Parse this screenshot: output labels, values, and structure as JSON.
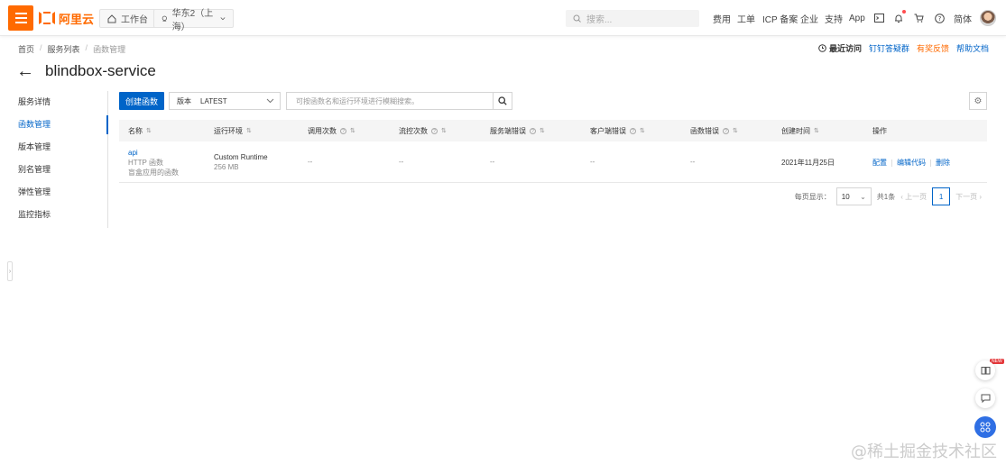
{
  "topbar": {
    "brand": "阿里云",
    "workbench": "工作台",
    "region": "华东2（上海）",
    "search_placeholder": "搜索...",
    "nav": [
      "费用",
      "工单",
      "ICP 备案",
      "企业",
      "支持",
      "App"
    ],
    "lang": "简体"
  },
  "breadcrumb": [
    "首页",
    "服务列表",
    "函数管理"
  ],
  "quick_links": {
    "recent": "最近访问",
    "dingtalk": "钉钉答疑群",
    "feedback": "有奖反馈",
    "help": "帮助文档"
  },
  "page_title": "blindbox-service",
  "sidenav": {
    "items": [
      "服务详情",
      "函数管理",
      "版本管理",
      "别名管理",
      "弹性管理",
      "监控指标"
    ],
    "active_index": 1
  },
  "toolbar": {
    "create_label": "创建函数",
    "version_label": "版本",
    "version_value": "LATEST",
    "search_placeholder": "可按函数名和运行环境进行模糊搜索。"
  },
  "table": {
    "columns": [
      "名称",
      "运行环境",
      "调用次数",
      "流控次数",
      "服务端错误",
      "客户端错误",
      "函数错误",
      "创建时间",
      "操作"
    ],
    "rows": [
      {
        "name": "api",
        "trigger": "HTTP 函数",
        "desc": "盲盒应用的函数",
        "runtime": "Custom Runtime",
        "memory": "256 MB",
        "invocations": "--",
        "throttles": "--",
        "server_errors": "--",
        "client_errors": "--",
        "function_errors": "--",
        "created": "2021年11月25日",
        "actions": [
          "配置",
          "编辑代码",
          "删除"
        ]
      }
    ]
  },
  "pagination": {
    "per_page_label": "每页显示：",
    "per_page": "10",
    "total": "共1条",
    "prev": "上一页",
    "current": "1",
    "next": "下一页"
  },
  "float_badge": "NEW",
  "watermark": "@稀土掘金技术社区",
  "colors": {
    "brand": "#ff6a00",
    "primary": "#0064c8"
  }
}
